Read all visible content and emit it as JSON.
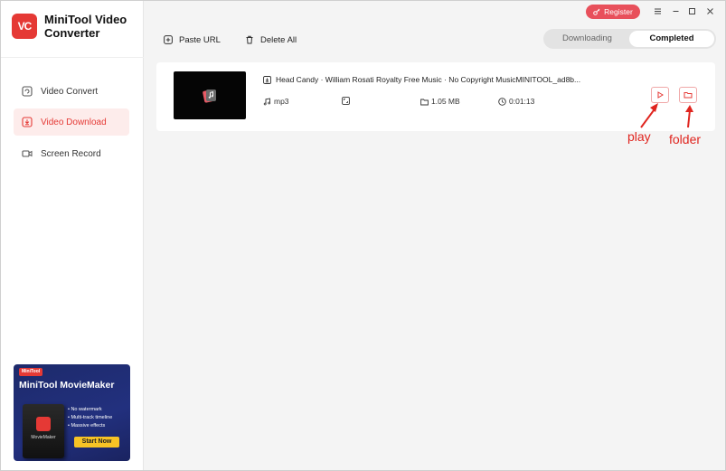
{
  "app": {
    "logo_text": "VC",
    "title": "MiniTool Video Converter"
  },
  "sidebar": {
    "items": [
      {
        "label": "Video Convert",
        "icon": "video-convert-icon",
        "active": false
      },
      {
        "label": "Video Download",
        "icon": "download-icon",
        "active": true
      },
      {
        "label": "Screen Record",
        "icon": "camera-icon",
        "active": false
      }
    ],
    "promo": {
      "badge": "MiniTool",
      "title": "MiniTool MovieMaker",
      "box_label": "MovieMaker",
      "features": [
        "• No watermark",
        "• Multi-track timeline",
        "• Massive effects"
      ],
      "button": "Start Now"
    }
  },
  "header": {
    "register_label": "Register",
    "window_controls": [
      "menu-icon",
      "minimize-icon",
      "maximize-icon",
      "close-icon"
    ]
  },
  "toolbar": {
    "paste_url": "Paste URL",
    "delete_all": "Delete All"
  },
  "tabs": {
    "downloading": "Downloading",
    "completed": "Completed",
    "active": "completed"
  },
  "downloads": [
    {
      "filename": "Head Candy · William Rosati  Royalty Free Music · No Copyright MusicMINITOOL_ad8b...",
      "format": "mp3",
      "size": "1.05 MB",
      "duration": "0:01:13"
    }
  ],
  "annotations": {
    "play": "play",
    "folder": "folder"
  },
  "colors": {
    "accent": "#e53935",
    "annotation": "#e0251f",
    "register": "#e8505b",
    "promo_button": "#f7c325"
  }
}
